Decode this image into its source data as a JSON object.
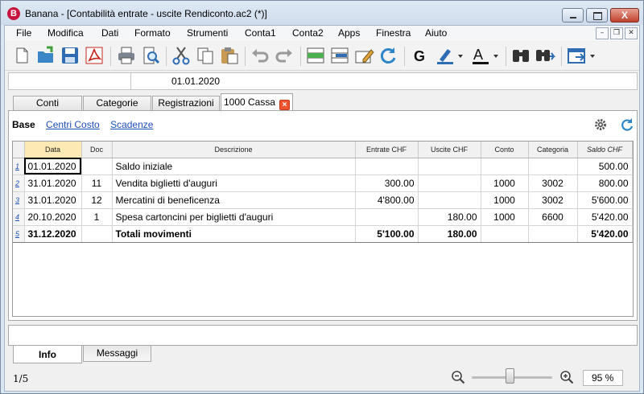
{
  "window": {
    "app_icon_letter": "B",
    "title": "Banana - [Contabilità entrate - uscite Rendiconto.ac2 (*)]",
    "close_glyph": "X"
  },
  "menu": {
    "items": [
      "File",
      "Modifica",
      "Dati",
      "Formato",
      "Strumenti",
      "Conta1",
      "Conta2",
      "Apps",
      "Finestra",
      "Aiuto"
    ]
  },
  "toolbar": {
    "icons": [
      "new-file-icon",
      "open-file-icon",
      "save-icon",
      "pdf-icon",
      "print-icon",
      "print-preview-icon",
      "cut-icon",
      "copy-icon",
      "paste-icon",
      "undo-icon",
      "redo-icon",
      "add-rows-icon",
      "delete-rows-icon",
      "edit-row-icon",
      "recalculate-icon",
      "bold-icon",
      "highlight-color-icon",
      "text-color-icon",
      "find-icon",
      "find-next-icon",
      "window-switch-icon"
    ],
    "bold_glyph": "G",
    "text_color_glyph": "A"
  },
  "cellbar": {
    "address": "",
    "value": "01.01.2020"
  },
  "tabs": [
    {
      "label": "Conti"
    },
    {
      "label": "Categorie"
    },
    {
      "label": "Registrazioni"
    },
    {
      "label": "1000 Cassa"
    }
  ],
  "tab_close_glyph": "×",
  "views": [
    {
      "label": "Base"
    },
    {
      "label": "Centri Costo"
    },
    {
      "label": "Scadenze"
    }
  ],
  "table": {
    "headers": [
      "Data",
      "Doc",
      "Descrizione",
      "Entrate CHF",
      "Uscite CHF",
      "Conto",
      "Categoria",
      "Saldo CHF"
    ],
    "rows": [
      {
        "n": "1",
        "data": "01.01.2020",
        "doc": "",
        "desc": "Saldo iniziale",
        "entrate": "",
        "uscite": "",
        "conto": "",
        "categoria": "",
        "saldo": "500.00"
      },
      {
        "n": "2",
        "data": "31.01.2020",
        "doc": "11",
        "desc": "Vendita biglietti d'auguri",
        "entrate": "300.00",
        "uscite": "",
        "conto": "1000",
        "categoria": "3002",
        "saldo": "800.00"
      },
      {
        "n": "3",
        "data": "31.01.2020",
        "doc": "12",
        "desc": "Mercatini di beneficenza",
        "entrate": "4'800.00",
        "uscite": "",
        "conto": "1000",
        "categoria": "3002",
        "saldo": "5'600.00"
      },
      {
        "n": "4",
        "data": "20.10.2020",
        "doc": "1",
        "desc": "Spesa cartoncini per biglietti d'auguri",
        "entrate": "",
        "uscite": "180.00",
        "conto": "1000",
        "categoria": "6600",
        "saldo": "5'420.00"
      },
      {
        "n": "5",
        "data": "31.12.2020",
        "doc": "",
        "desc": "Totali movimenti",
        "entrate": "5'100.00",
        "uscite": "180.00",
        "conto": "",
        "categoria": "",
        "saldo": "5'420.00"
      }
    ]
  },
  "bottom_tabs": [
    {
      "label": "Info"
    },
    {
      "label": "Messaggi"
    }
  ],
  "status": {
    "position": "1/5",
    "zoom": "95 %",
    "zoom_slider_fraction": 0.47
  },
  "colors": {
    "accent_link": "#1d4fb6",
    "header_selected": "#fde9b3",
    "close_button": "#c0412c",
    "tab_close": "#f0532d"
  }
}
